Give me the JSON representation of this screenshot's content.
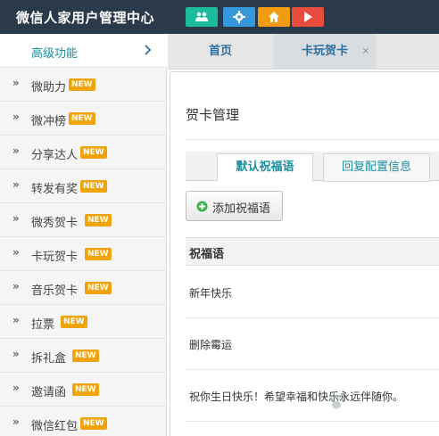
{
  "header": {
    "title": "微信人家用户管理中心",
    "buttons": [
      {
        "icon": "users-icon",
        "color": "#1abc9c"
      },
      {
        "icon": "gear-icon",
        "color": "#3498db"
      },
      {
        "icon": "home-icon",
        "color": "#f39c12"
      },
      {
        "icon": "play-icon",
        "color": "#e74c3c"
      }
    ]
  },
  "sidebar": {
    "header_label": "高级功能",
    "badge_text": "NEW",
    "items": [
      {
        "label": "微助力",
        "badge": "NEW"
      },
      {
        "label": "微冲榜",
        "badge": "NEW"
      },
      {
        "label": "分享达人",
        "badge": "NEW"
      },
      {
        "label": "转发有奖",
        "badge": "NEW"
      },
      {
        "label": "微秀贺卡",
        "badge": "NEW"
      },
      {
        "label": "卡玩贺卡",
        "badge": "NEW"
      },
      {
        "label": "音乐贺卡",
        "badge": "NEW"
      },
      {
        "label": "拉票",
        "badge": "NEW"
      },
      {
        "label": "拆礼盒",
        "badge": "NEW"
      },
      {
        "label": "邀请函",
        "badge": "NEW"
      },
      {
        "label": "微信红包",
        "badge": "NEW"
      }
    ]
  },
  "tabs": {
    "home": "首页",
    "card": "卡玩贺卡",
    "close": "×"
  },
  "panel": {
    "title": "贺卡管理",
    "subtabs": [
      "默认祝福语",
      "回复配置信息"
    ],
    "add_button": "添加祝福语",
    "table_header": "祝福语",
    "rows": [
      "新年快乐",
      "删除霉运",
      "祝你生日快乐！希望幸福和快乐永远伴随你。"
    ]
  },
  "colors": {
    "topbar": "#2b3a4a",
    "accent": "#1a8fa0",
    "badge": "#f0a30a"
  }
}
